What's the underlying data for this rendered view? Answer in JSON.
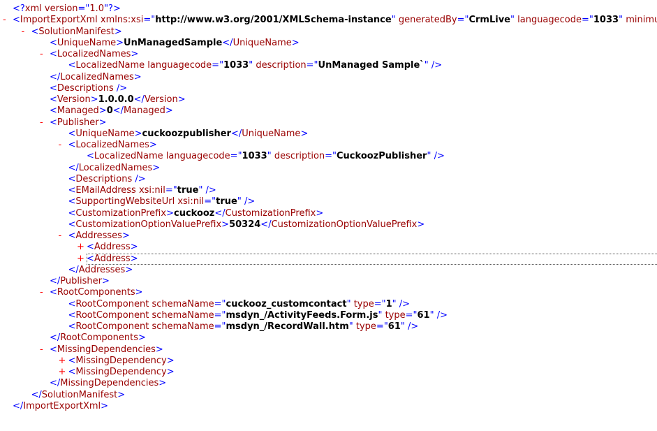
{
  "lines": [
    {
      "indent": 0,
      "toggle": "",
      "focused": false,
      "parts": [
        {
          "k": "p",
          "s": "<?"
        },
        {
          "k": "t",
          "s": "xml version"
        },
        {
          "k": "p",
          "s": "=\""
        },
        {
          "k": "t",
          "s": "1.0"
        },
        {
          "k": "p",
          "s": "\"?>"
        }
      ]
    },
    {
      "indent": 0,
      "toggle": "-",
      "focused": false,
      "parts": [
        {
          "k": "p",
          "s": "<"
        },
        {
          "k": "t",
          "s": "ImportExportXml "
        },
        {
          "k": "t",
          "s": "xmlns:xsi"
        },
        {
          "k": "p",
          "s": "=\""
        },
        {
          "k": "v",
          "s": "http://www.w3.org/2001/XMLSchema-instance"
        },
        {
          "k": "p",
          "s": "\" "
        },
        {
          "k": "t",
          "s": "generatedBy"
        },
        {
          "k": "p",
          "s": "=\""
        },
        {
          "k": "v",
          "s": "CrmLive"
        },
        {
          "k": "p",
          "s": "\" "
        },
        {
          "k": "t",
          "s": "languagecode"
        },
        {
          "k": "p",
          "s": "=\""
        },
        {
          "k": "v",
          "s": "1033"
        },
        {
          "k": "p",
          "s": "\" "
        },
        {
          "k": "t",
          "s": "minimumversion"
        }
      ]
    },
    {
      "indent": 1,
      "toggle": "-",
      "focused": false,
      "parts": [
        {
          "k": "p",
          "s": "<"
        },
        {
          "k": "t",
          "s": "SolutionManifest"
        },
        {
          "k": "p",
          "s": ">"
        }
      ]
    },
    {
      "indent": 2,
      "toggle": "",
      "focused": false,
      "parts": [
        {
          "k": "p",
          "s": "<"
        },
        {
          "k": "t",
          "s": "UniqueName"
        },
        {
          "k": "p",
          "s": ">"
        },
        {
          "k": "v",
          "s": "UnManagedSample"
        },
        {
          "k": "p",
          "s": "</"
        },
        {
          "k": "t",
          "s": "UniqueName"
        },
        {
          "k": "p",
          "s": ">"
        }
      ]
    },
    {
      "indent": 2,
      "toggle": "-",
      "focused": false,
      "parts": [
        {
          "k": "p",
          "s": "<"
        },
        {
          "k": "t",
          "s": "LocalizedNames"
        },
        {
          "k": "p",
          "s": ">"
        }
      ]
    },
    {
      "indent": 3,
      "toggle": "",
      "focused": false,
      "parts": [
        {
          "k": "p",
          "s": "<"
        },
        {
          "k": "t",
          "s": "LocalizedName "
        },
        {
          "k": "t",
          "s": "languagecode"
        },
        {
          "k": "p",
          "s": "=\""
        },
        {
          "k": "v",
          "s": "1033"
        },
        {
          "k": "p",
          "s": "\" "
        },
        {
          "k": "t",
          "s": "description"
        },
        {
          "k": "p",
          "s": "=\""
        },
        {
          "k": "v",
          "s": "UnManaged Sample`"
        },
        {
          "k": "p",
          "s": "\" />"
        }
      ]
    },
    {
      "indent": 2,
      "toggle": "",
      "focused": false,
      "parts": [
        {
          "k": "p",
          "s": "</"
        },
        {
          "k": "t",
          "s": "LocalizedNames"
        },
        {
          "k": "p",
          "s": ">"
        }
      ]
    },
    {
      "indent": 2,
      "toggle": "",
      "focused": false,
      "parts": [
        {
          "k": "p",
          "s": "<"
        },
        {
          "k": "t",
          "s": "Descriptions"
        },
        {
          "k": "p",
          "s": " />"
        }
      ]
    },
    {
      "indent": 2,
      "toggle": "",
      "focused": false,
      "parts": [
        {
          "k": "p",
          "s": "<"
        },
        {
          "k": "t",
          "s": "Version"
        },
        {
          "k": "p",
          "s": ">"
        },
        {
          "k": "v",
          "s": "1.0.0.0"
        },
        {
          "k": "p",
          "s": "</"
        },
        {
          "k": "t",
          "s": "Version"
        },
        {
          "k": "p",
          "s": ">"
        }
      ]
    },
    {
      "indent": 2,
      "toggle": "",
      "focused": false,
      "parts": [
        {
          "k": "p",
          "s": "<"
        },
        {
          "k": "t",
          "s": "Managed"
        },
        {
          "k": "p",
          "s": ">"
        },
        {
          "k": "v",
          "s": "0"
        },
        {
          "k": "p",
          "s": "</"
        },
        {
          "k": "t",
          "s": "Managed"
        },
        {
          "k": "p",
          "s": ">"
        }
      ]
    },
    {
      "indent": 2,
      "toggle": "-",
      "focused": false,
      "parts": [
        {
          "k": "p",
          "s": "<"
        },
        {
          "k": "t",
          "s": "Publisher"
        },
        {
          "k": "p",
          "s": ">"
        }
      ]
    },
    {
      "indent": 3,
      "toggle": "",
      "focused": false,
      "parts": [
        {
          "k": "p",
          "s": "<"
        },
        {
          "k": "t",
          "s": "UniqueName"
        },
        {
          "k": "p",
          "s": ">"
        },
        {
          "k": "v",
          "s": "cuckoozpublisher"
        },
        {
          "k": "p",
          "s": "</"
        },
        {
          "k": "t",
          "s": "UniqueName"
        },
        {
          "k": "p",
          "s": ">"
        }
      ]
    },
    {
      "indent": 3,
      "toggle": "-",
      "focused": false,
      "parts": [
        {
          "k": "p",
          "s": "<"
        },
        {
          "k": "t",
          "s": "LocalizedNames"
        },
        {
          "k": "p",
          "s": ">"
        }
      ]
    },
    {
      "indent": 4,
      "toggle": "",
      "focused": false,
      "parts": [
        {
          "k": "p",
          "s": "<"
        },
        {
          "k": "t",
          "s": "LocalizedName "
        },
        {
          "k": "t",
          "s": "languagecode"
        },
        {
          "k": "p",
          "s": "=\""
        },
        {
          "k": "v",
          "s": "1033"
        },
        {
          "k": "p",
          "s": "\" "
        },
        {
          "k": "t",
          "s": "description"
        },
        {
          "k": "p",
          "s": "=\""
        },
        {
          "k": "v",
          "s": "CuckoozPublisher"
        },
        {
          "k": "p",
          "s": "\" />"
        }
      ]
    },
    {
      "indent": 3,
      "toggle": "",
      "focused": false,
      "parts": [
        {
          "k": "p",
          "s": "</"
        },
        {
          "k": "t",
          "s": "LocalizedNames"
        },
        {
          "k": "p",
          "s": ">"
        }
      ]
    },
    {
      "indent": 3,
      "toggle": "",
      "focused": false,
      "parts": [
        {
          "k": "p",
          "s": "<"
        },
        {
          "k": "t",
          "s": "Descriptions"
        },
        {
          "k": "p",
          "s": " />"
        }
      ]
    },
    {
      "indent": 3,
      "toggle": "",
      "focused": false,
      "parts": [
        {
          "k": "p",
          "s": "<"
        },
        {
          "k": "t",
          "s": "EMailAddress "
        },
        {
          "k": "t",
          "s": "xsi:nil"
        },
        {
          "k": "p",
          "s": "=\""
        },
        {
          "k": "v",
          "s": "true"
        },
        {
          "k": "p",
          "s": "\" />"
        }
      ]
    },
    {
      "indent": 3,
      "toggle": "",
      "focused": false,
      "parts": [
        {
          "k": "p",
          "s": "<"
        },
        {
          "k": "t",
          "s": "SupportingWebsiteUrl "
        },
        {
          "k": "t",
          "s": "xsi:nil"
        },
        {
          "k": "p",
          "s": "=\""
        },
        {
          "k": "v",
          "s": "true"
        },
        {
          "k": "p",
          "s": "\" />"
        }
      ]
    },
    {
      "indent": 3,
      "toggle": "",
      "focused": false,
      "parts": [
        {
          "k": "p",
          "s": "<"
        },
        {
          "k": "t",
          "s": "CustomizationPrefix"
        },
        {
          "k": "p",
          "s": ">"
        },
        {
          "k": "v",
          "s": "cuckooz"
        },
        {
          "k": "p",
          "s": "</"
        },
        {
          "k": "t",
          "s": "CustomizationPrefix"
        },
        {
          "k": "p",
          "s": ">"
        }
      ]
    },
    {
      "indent": 3,
      "toggle": "",
      "focused": false,
      "parts": [
        {
          "k": "p",
          "s": "<"
        },
        {
          "k": "t",
          "s": "CustomizationOptionValuePrefix"
        },
        {
          "k": "p",
          "s": ">"
        },
        {
          "k": "v",
          "s": "50324"
        },
        {
          "k": "p",
          "s": "</"
        },
        {
          "k": "t",
          "s": "CustomizationOptionValuePrefix"
        },
        {
          "k": "p",
          "s": ">"
        }
      ]
    },
    {
      "indent": 3,
      "toggle": "-",
      "focused": false,
      "parts": [
        {
          "k": "p",
          "s": "<"
        },
        {
          "k": "t",
          "s": "Addresses"
        },
        {
          "k": "p",
          "s": ">"
        }
      ]
    },
    {
      "indent": 4,
      "toggle": "+",
      "focused": false,
      "parts": [
        {
          "k": "p",
          "s": "<"
        },
        {
          "k": "t",
          "s": "Address"
        },
        {
          "k": "p",
          "s": ">"
        }
      ]
    },
    {
      "indent": 4,
      "toggle": "+",
      "focused": true,
      "parts": [
        {
          "k": "p",
          "s": "<"
        },
        {
          "k": "t",
          "s": "Address"
        },
        {
          "k": "p",
          "s": ">"
        }
      ]
    },
    {
      "indent": 3,
      "toggle": "",
      "focused": false,
      "parts": [
        {
          "k": "p",
          "s": "</"
        },
        {
          "k": "t",
          "s": "Addresses"
        },
        {
          "k": "p",
          "s": ">"
        }
      ]
    },
    {
      "indent": 2,
      "toggle": "",
      "focused": false,
      "parts": [
        {
          "k": "p",
          "s": "</"
        },
        {
          "k": "t",
          "s": "Publisher"
        },
        {
          "k": "p",
          "s": ">"
        }
      ]
    },
    {
      "indent": 2,
      "toggle": "-",
      "focused": false,
      "parts": [
        {
          "k": "p",
          "s": "<"
        },
        {
          "k": "t",
          "s": "RootComponents"
        },
        {
          "k": "p",
          "s": ">"
        }
      ]
    },
    {
      "indent": 3,
      "toggle": "",
      "focused": false,
      "parts": [
        {
          "k": "p",
          "s": "<"
        },
        {
          "k": "t",
          "s": "RootComponent "
        },
        {
          "k": "t",
          "s": "schemaName"
        },
        {
          "k": "p",
          "s": "=\""
        },
        {
          "k": "v",
          "s": "cuckooz_customcontact"
        },
        {
          "k": "p",
          "s": "\" "
        },
        {
          "k": "t",
          "s": "type"
        },
        {
          "k": "p",
          "s": "=\""
        },
        {
          "k": "v",
          "s": "1"
        },
        {
          "k": "p",
          "s": "\" />"
        }
      ]
    },
    {
      "indent": 3,
      "toggle": "",
      "focused": false,
      "parts": [
        {
          "k": "p",
          "s": "<"
        },
        {
          "k": "t",
          "s": "RootComponent "
        },
        {
          "k": "t",
          "s": "schemaName"
        },
        {
          "k": "p",
          "s": "=\""
        },
        {
          "k": "v",
          "s": "msdyn_/ActivityFeeds.Form.js"
        },
        {
          "k": "p",
          "s": "\" "
        },
        {
          "k": "t",
          "s": "type"
        },
        {
          "k": "p",
          "s": "=\""
        },
        {
          "k": "v",
          "s": "61"
        },
        {
          "k": "p",
          "s": "\" />"
        }
      ]
    },
    {
      "indent": 3,
      "toggle": "",
      "focused": false,
      "parts": [
        {
          "k": "p",
          "s": "<"
        },
        {
          "k": "t",
          "s": "RootComponent "
        },
        {
          "k": "t",
          "s": "schemaName"
        },
        {
          "k": "p",
          "s": "=\""
        },
        {
          "k": "v",
          "s": "msdyn_/RecordWall.htm"
        },
        {
          "k": "p",
          "s": "\" "
        },
        {
          "k": "t",
          "s": "type"
        },
        {
          "k": "p",
          "s": "=\""
        },
        {
          "k": "v",
          "s": "61"
        },
        {
          "k": "p",
          "s": "\" />"
        }
      ]
    },
    {
      "indent": 2,
      "toggle": "",
      "focused": false,
      "parts": [
        {
          "k": "p",
          "s": "</"
        },
        {
          "k": "t",
          "s": "RootComponents"
        },
        {
          "k": "p",
          "s": ">"
        }
      ]
    },
    {
      "indent": 2,
      "toggle": "-",
      "focused": false,
      "parts": [
        {
          "k": "p",
          "s": "<"
        },
        {
          "k": "t",
          "s": "MissingDependencies"
        },
        {
          "k": "p",
          "s": ">"
        }
      ]
    },
    {
      "indent": 3,
      "toggle": "+",
      "focused": false,
      "parts": [
        {
          "k": "p",
          "s": "<"
        },
        {
          "k": "t",
          "s": "MissingDependency"
        },
        {
          "k": "p",
          "s": ">"
        }
      ]
    },
    {
      "indent": 3,
      "toggle": "+",
      "focused": false,
      "parts": [
        {
          "k": "p",
          "s": "<"
        },
        {
          "k": "t",
          "s": "MissingDependency"
        },
        {
          "k": "p",
          "s": ">"
        }
      ]
    },
    {
      "indent": 2,
      "toggle": "",
      "focused": false,
      "parts": [
        {
          "k": "p",
          "s": "</"
        },
        {
          "k": "t",
          "s": "MissingDependencies"
        },
        {
          "k": "p",
          "s": ">"
        }
      ]
    },
    {
      "indent": 1,
      "toggle": "",
      "focused": false,
      "parts": [
        {
          "k": "p",
          "s": "</"
        },
        {
          "k": "t",
          "s": "SolutionManifest"
        },
        {
          "k": "p",
          "s": ">"
        }
      ]
    },
    {
      "indent": 0,
      "toggle": "",
      "focused": false,
      "parts": [
        {
          "k": "p",
          "s": "</"
        },
        {
          "k": "t",
          "s": "ImportExportXml"
        },
        {
          "k": "p",
          "s": ">"
        }
      ]
    }
  ]
}
